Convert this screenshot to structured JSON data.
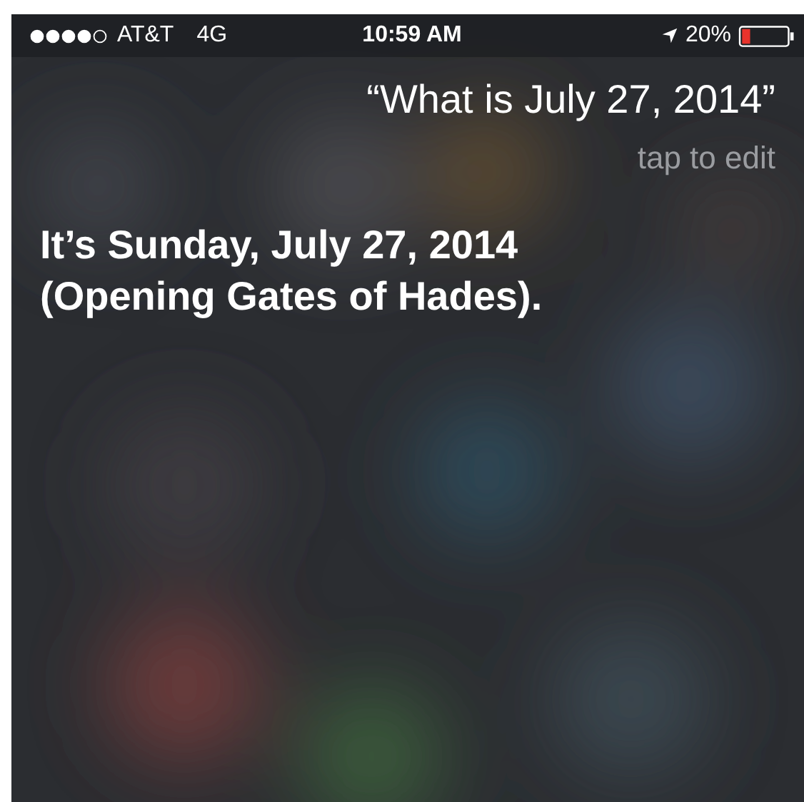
{
  "status_bar": {
    "carrier": "AT&T",
    "network": "4G",
    "time": "10:59 AM",
    "battery_percent": "20%"
  },
  "query": {
    "text": "“What is July 27, 2014”",
    "hint": "tap to edit"
  },
  "answer": {
    "lines": [
      "It’s Sunday, July 27, 2014",
      "(Opening Gates of Hades)."
    ]
  }
}
